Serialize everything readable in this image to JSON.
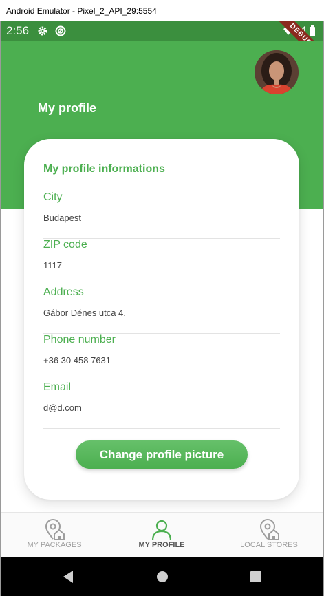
{
  "window": {
    "title": "Android Emulator - Pixel_2_API_29:5554"
  },
  "status_bar": {
    "time": "2:56",
    "debug_label": "DEBUG"
  },
  "header": {
    "title": "My profile"
  },
  "card": {
    "title": "My profile informations",
    "fields": [
      {
        "label": "City",
        "value": "Budapest"
      },
      {
        "label": "ZIP code",
        "value": "1117"
      },
      {
        "label": "Address",
        "value": "Gábor Dénes utca 4."
      },
      {
        "label": "Phone number",
        "value": "+36 30 458 7631"
      },
      {
        "label": "Email",
        "value": "d@d.com"
      }
    ],
    "button_label": "Change profile picture"
  },
  "bottom_nav": {
    "items": [
      {
        "label": "MY PACKAGES",
        "icon": "location-home-icon",
        "active": false
      },
      {
        "label": "MY PROFILE",
        "icon": "person-icon",
        "active": true
      },
      {
        "label": "LOCAL STORES",
        "icon": "location-home-icon",
        "active": false
      }
    ]
  },
  "colors": {
    "primary": "#4caf50",
    "status_bar": "#3b8f3e",
    "debug_ribbon": "#8b2a1f"
  }
}
